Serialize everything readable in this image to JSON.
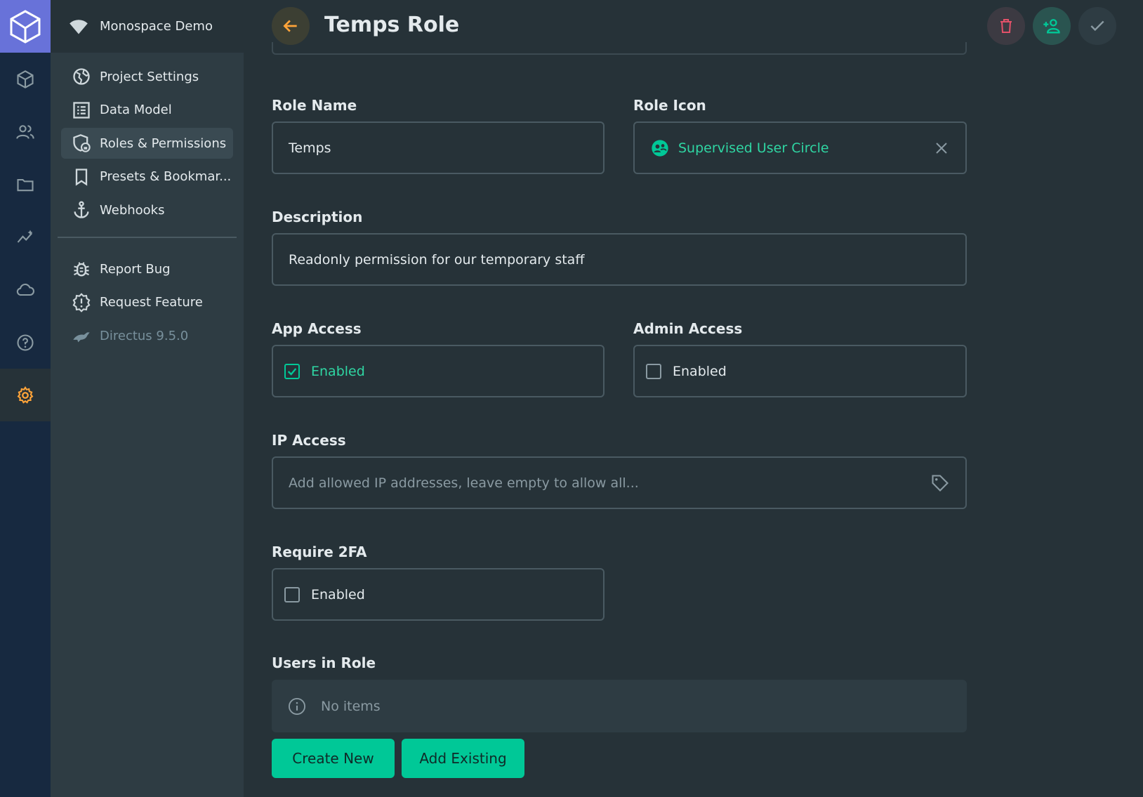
{
  "project": {
    "name": "Monospace Demo"
  },
  "modules": [
    {
      "icon": "box-icon"
    },
    {
      "icon": "users-icon"
    },
    {
      "icon": "folder-icon"
    },
    {
      "icon": "insights-icon"
    },
    {
      "icon": "cloud-icon"
    },
    {
      "icon": "help-icon"
    },
    {
      "icon": "settings-icon",
      "active": true
    }
  ],
  "nav": {
    "items": [
      {
        "label": "Project Settings",
        "icon": "globe-icon"
      },
      {
        "label": "Data Model",
        "icon": "list-icon"
      },
      {
        "label": "Roles & Permissions",
        "icon": "shield-icon",
        "active": true
      },
      {
        "label": "Presets & Bookmar...",
        "icon": "bookmark-icon"
      },
      {
        "label": "Webhooks",
        "icon": "anchor-icon"
      }
    ],
    "extra": [
      {
        "label": "Report Bug",
        "icon": "bug-icon"
      },
      {
        "label": "Request Feature",
        "icon": "feature-icon"
      },
      {
        "label": "Directus 9.5.0",
        "icon": "rabbit-icon"
      }
    ]
  },
  "header": {
    "title": "Temps Role"
  },
  "form": {
    "role_name": {
      "label": "Role Name",
      "value": "Temps"
    },
    "role_icon": {
      "label": "Role Icon",
      "value": "Supervised User Circle"
    },
    "description": {
      "label": "Description",
      "value": "Readonly permission for our temporary staff"
    },
    "app_access": {
      "label": "App Access",
      "option": "Enabled",
      "checked": true
    },
    "admin_access": {
      "label": "Admin Access",
      "option": "Enabled",
      "checked": false
    },
    "ip_access": {
      "label": "IP Access",
      "placeholder": "Add allowed IP addresses, leave empty to allow all..."
    },
    "require_2fa": {
      "label": "Require 2FA",
      "option": "Enabled",
      "checked": false
    },
    "users_in_role": {
      "label": "Users in Role",
      "empty_text": "No items"
    },
    "buttons": {
      "create_new": "Create New",
      "add_existing": "Add Existing"
    }
  },
  "colors": {
    "accent": "#00c897",
    "warning": "#ffa439",
    "danger": "#e35169",
    "brand": "#6872d9"
  }
}
